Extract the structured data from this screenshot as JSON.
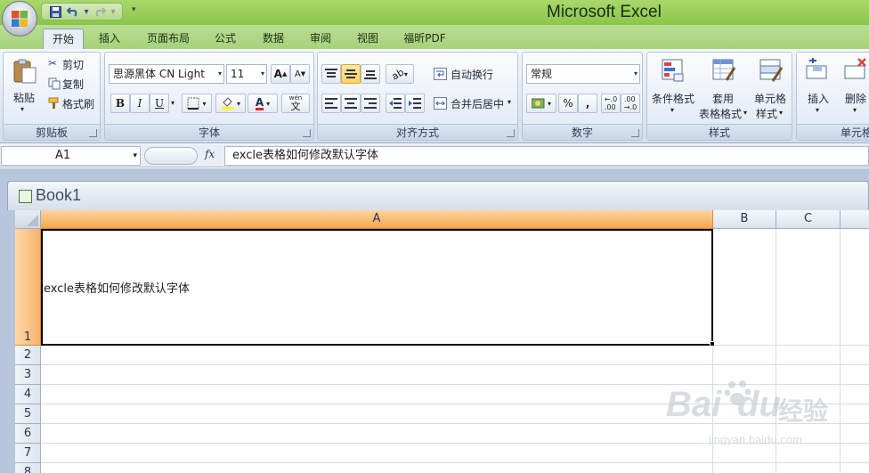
{
  "app": {
    "title": "Microsoft Excel"
  },
  "tabs": [
    "开始",
    "插入",
    "页面布局",
    "公式",
    "数据",
    "审阅",
    "视图",
    "福昕PDF"
  ],
  "ribbon": {
    "clipboard": {
      "label": "剪贴板",
      "paste": "粘贴",
      "cut": "剪切",
      "copy": "复制",
      "format_painter": "格式刷"
    },
    "font": {
      "label": "字体",
      "name": "思源黑体 CN Light",
      "size": "11",
      "bold": "B",
      "italic": "I",
      "underline": "U",
      "font_color_glyph": "A",
      "phonetic_glyph": "wén",
      "phonetic_char": "文"
    },
    "alignment": {
      "label": "对齐方式",
      "wrap": "自动换行",
      "merge": "合并后居中"
    },
    "number": {
      "label": "数字",
      "format": "常规",
      "percent": "%",
      "comma": ","
    },
    "styles": {
      "label": "样式",
      "conditional": "条件格式",
      "table1": "套用",
      "table2": "表格格式",
      "cell1": "单元格",
      "cell2": "样式"
    },
    "cells": {
      "label": "单元格",
      "insert": "插入",
      "delete": "删除"
    }
  },
  "formula_bar": {
    "cell_ref": "A1",
    "fx": "fx",
    "value": "excle表格如何修改默认字体"
  },
  "workbook": {
    "name": "Book1"
  },
  "sheet": {
    "columns": [
      "A",
      "B",
      "C"
    ],
    "rows": [
      "1",
      "2",
      "3",
      "4",
      "5",
      "6",
      "7",
      "8"
    ],
    "a1_value": "excle表格如何修改默认字体"
  },
  "watermark": {
    "brand": "Bai",
    "brand2": "du",
    "cn": "经验",
    "url": "jingyan.baidu.com"
  },
  "colors": {
    "title_green": "#8ac64a",
    "selected_header": "#f7a552",
    "ribbon_blue": "#dfe7f1"
  }
}
